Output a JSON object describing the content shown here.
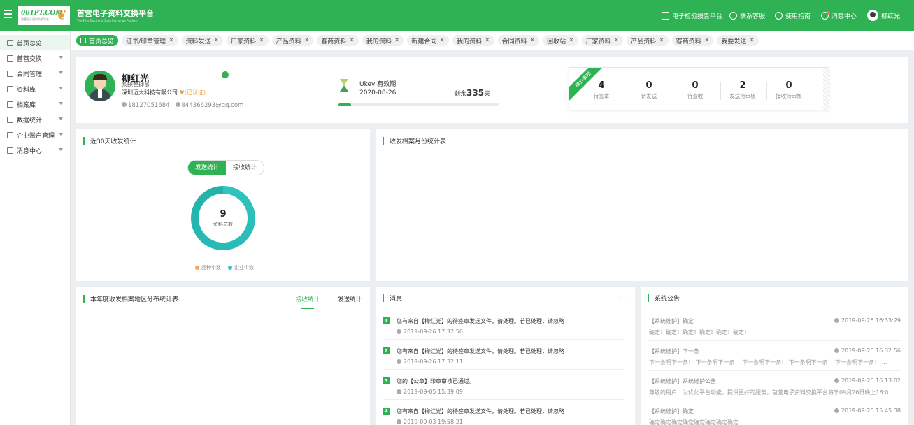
{
  "header": {
    "logo_text": "001PT.COM",
    "logo_sub": "首营电子资料交换平台",
    "site_title": "首营电子资料交换平台",
    "site_subtitle": "The First Electronic Data Exchange Platform",
    "links": [
      "电子检验报告平台",
      "联系客服",
      "使用指南",
      "消息中心"
    ],
    "username": "柳红光",
    "accent_color": "#2fb254"
  },
  "sidebar": {
    "items": [
      {
        "label": "首页总览",
        "icon": "home-icon",
        "active": true
      },
      {
        "label": "首营交换",
        "icon": "exchange-icon"
      },
      {
        "label": "合同管理",
        "icon": "contract-icon"
      },
      {
        "label": "资料库",
        "icon": "library-icon"
      },
      {
        "label": "档案库",
        "icon": "archive-icon"
      },
      {
        "label": "数据统计",
        "icon": "chart-icon"
      },
      {
        "label": "企业账户管理",
        "icon": "company-icon"
      },
      {
        "label": "消息中心",
        "icon": "message-icon"
      }
    ]
  },
  "tabs": [
    "首页总览",
    "证书/印章管理",
    "资料发送",
    "厂家资料",
    "产品资料",
    "客商资料",
    "我的资料",
    "新建合同",
    "我的资料",
    "合同资料",
    "回收站",
    "厂家资料",
    "产品资料",
    "客商资料",
    "我要发送"
  ],
  "user": {
    "name": "柳红光",
    "role": "系统管理员",
    "company": "深圳迈大科技有限公司",
    "verified": "(已认证)",
    "phone": "18127051684",
    "email": "844366293@qq.com"
  },
  "ukey": {
    "title": "Ukey 有效期",
    "date": "2020-08-26",
    "remain_prefix": "剩余",
    "remain_days": "335",
    "remain_suffix": "天",
    "progress": 0.08
  },
  "todo": {
    "ribbon": "待办事项",
    "items": [
      {
        "num": "4",
        "label": "待签章"
      },
      {
        "num": "0",
        "label": "待发送"
      },
      {
        "num": "0",
        "label": "待查收"
      },
      {
        "num": "2",
        "label": "发送待审核"
      },
      {
        "num": "0",
        "label": "接收待审核"
      }
    ]
  },
  "stats30": {
    "title": "近30天收发统计",
    "seg": [
      "发送统计",
      "接收统计"
    ],
    "total": "9",
    "total_label": "资料总数",
    "legend": [
      "品种个数",
      "企业个数"
    ]
  },
  "month": {
    "title": "收发档案月份统计表"
  },
  "region": {
    "title": "本年度收发档案地区分布统计表",
    "tabs": [
      "接收统计",
      "发送统计"
    ]
  },
  "messages": {
    "title": "消息",
    "more": "···",
    "items": [
      {
        "no": "1",
        "text": "您有来自【柳红光】的待签章发送文件，请处理。若已处理，请忽略",
        "time": "2019-09-26 17:32:50"
      },
      {
        "no": "2",
        "text": "您有来自【柳红光】的待签章发送文件，请处理。若已处理，请忽略",
        "time": "2019-09-26 17:32:11"
      },
      {
        "no": "3",
        "text": "您的【公章】印章审核已通过。",
        "time": "2019-09-05 15:39:09"
      },
      {
        "no": "4",
        "text": "您有来自【柳红光】的待签章发送文件，请处理。若已处理，请忽略",
        "time": "2019-09-03 19:58:21"
      }
    ]
  },
  "notices": {
    "title": "系统公告",
    "items": [
      {
        "title": "【系统维护】确定",
        "date": "2019-09-26 16:33:29",
        "body": "确定！确定！确定！确定！确定！确定！"
      },
      {
        "title": "【系统维护】下一条",
        "date": "2019-09-26 16:32:56",
        "body": "下一条啊下一条！ 下一条啊下一条！ 下一条啊下一条！ 下一条啊下一条！ 下一条啊下一条！ ..."
      },
      {
        "title": "【系统维护】系统维护公告",
        "date": "2019-09-26 16:13:02",
        "body": "尊敬的用户：为优化平台功能，提供更好的服务，首营电子资料交换平台将于09月26日晚上18:0..."
      },
      {
        "title": "【系统维护】确定",
        "date": "2019-09-26 15:45:38",
        "body": "确定确定确定确定确定确定确定确定"
      }
    ]
  }
}
